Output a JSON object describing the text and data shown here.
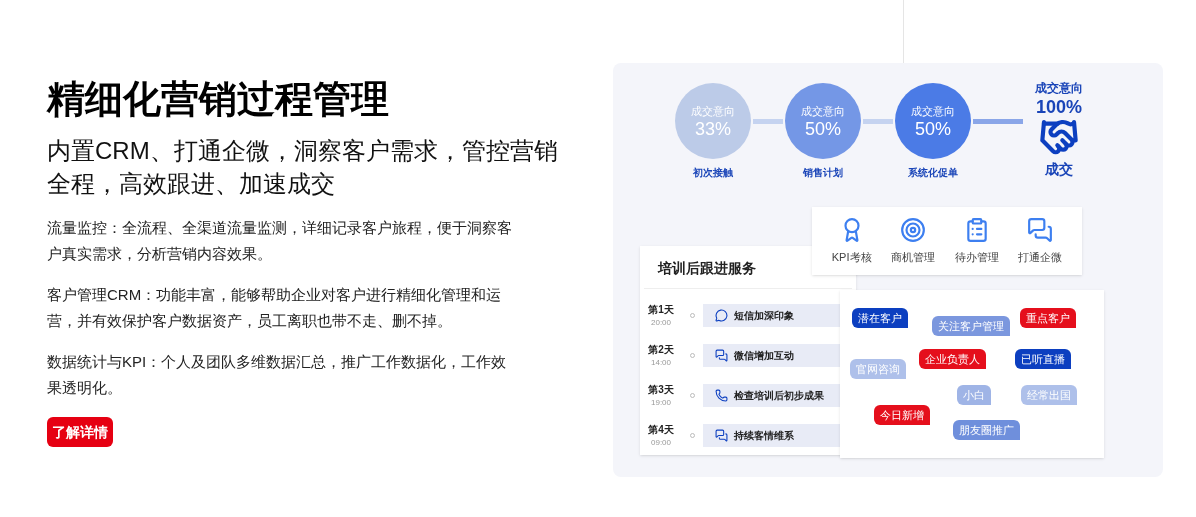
{
  "title": "精细化营销过程管理",
  "subtitle": "内置CRM、打通企微，洞察客户需求，管控营销全程，高效跟进、加速成交",
  "paragraphs": [
    "流量监控：全流程、全渠道流量监测，详细记录客户旅程，便于洞察客户真实需求，分析营销内容效果。",
    "客户管理CRM：功能丰富，能够帮助企业对客户进行精细化管理和运营，并有效保护客户数据资产，员工离职也带不走、删不掉。",
    "数据统计与KPI：个人及团队多维数据汇总，推广工作数据化，工作效果透明化。"
  ],
  "button": "了解详情",
  "funnel": [
    {
      "heading": "成交意向",
      "percent": "33%",
      "label": "初次接触",
      "color": "#bccbe8"
    },
    {
      "heading": "成交意向",
      "percent": "50%",
      "label": "销售计划",
      "color": "#7497e6"
    },
    {
      "heading": "成交意向",
      "percent": "50%",
      "label": "系统化促单",
      "color": "#4b7be6"
    }
  ],
  "deal": {
    "heading": "成交意向",
    "percent": "100%",
    "label": "成交"
  },
  "features": [
    {
      "kind": "award",
      "label": "KPI考核"
    },
    {
      "kind": "target",
      "label": "商机管理"
    },
    {
      "kind": "todo",
      "label": "待办管理"
    },
    {
      "kind": "chat",
      "label": "打通企微"
    }
  ],
  "followup": {
    "title": "培训后跟进服务",
    "days": [
      {
        "day": "第1天",
        "time": "20:00",
        "kind": "sms",
        "task": "短信加深印象"
      },
      {
        "day": "第2天",
        "time": "14:00",
        "kind": "wechat",
        "task": "微信增加互动"
      },
      {
        "day": "第3天",
        "time": "19:00",
        "kind": "phone",
        "task": "检查培训后初步成果"
      },
      {
        "day": "第4天",
        "time": "09:00",
        "kind": "wechat",
        "task": "持续客情维系"
      }
    ]
  },
  "tags": [
    {
      "text": "潜在客户",
      "color": "#0c3fc0"
    },
    {
      "text": "关注客户管理",
      "color": "#7b97de"
    },
    {
      "text": "重点客户",
      "color": "#e50f1c"
    },
    {
      "text": "官网咨询",
      "color": "#aec0ea"
    },
    {
      "text": "企业负责人",
      "color": "#e50f1c"
    },
    {
      "text": "已听直播",
      "color": "#0c3fc0"
    },
    {
      "text": "小白",
      "color": "#9fb4e6"
    },
    {
      "text": "经常出国",
      "color": "#aec0ea"
    },
    {
      "text": "今日新增",
      "color": "#e50f1c"
    },
    {
      "text": "朋友圈推广",
      "color": "#6f8fdc"
    }
  ]
}
